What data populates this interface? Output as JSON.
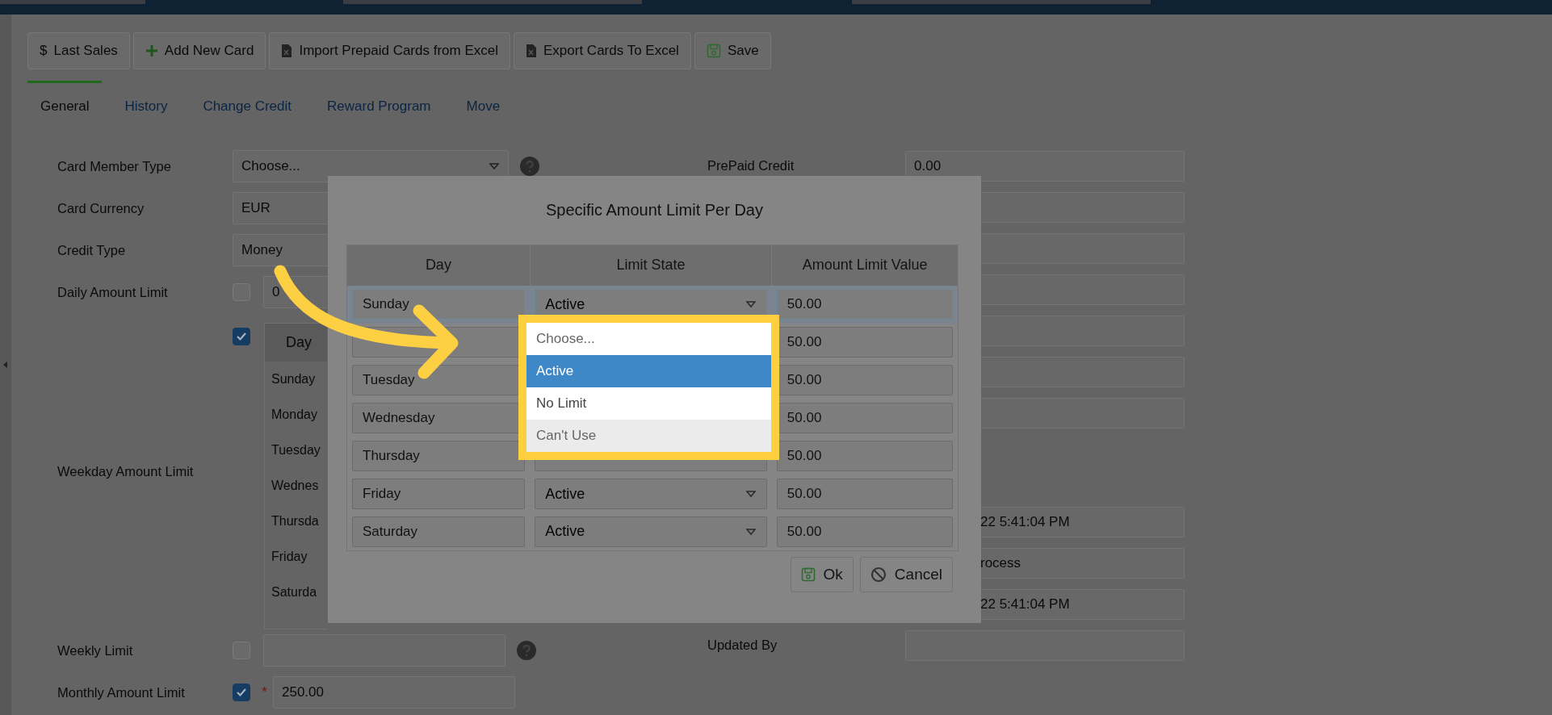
{
  "toolbar": [
    {
      "label": "Last Sales",
      "symbol": "$"
    },
    {
      "label": "Add New Card",
      "kind": "plus"
    },
    {
      "label": "Import Prepaid Cards from Excel",
      "kind": "excel"
    },
    {
      "label": "Export Cards To Excel",
      "kind": "excel"
    },
    {
      "label": "Save",
      "kind": "save"
    }
  ],
  "tabs": [
    {
      "label": "General",
      "selected": true
    },
    {
      "label": "History",
      "selected": false
    },
    {
      "label": "Change Credit",
      "selected": false
    },
    {
      "label": "Reward Program",
      "selected": false
    },
    {
      "label": "Move",
      "selected": false
    }
  ],
  "left_form": {
    "rows": [
      {
        "label": "Card Member Type",
        "kind": "select",
        "value": "Choose...",
        "help": true
      },
      {
        "label": "Card Currency",
        "kind": "text",
        "value": "EUR"
      },
      {
        "label": "Credit Type",
        "kind": "text",
        "value": "Money"
      },
      {
        "label": "Daily Amount Limit",
        "kind": "check_text",
        "checked": false,
        "value": "0"
      },
      {
        "label": "Weekday Amount Limit",
        "kind": "weekday_table",
        "checked": true,
        "header": "Day",
        "days": [
          "Sunday",
          "Monday",
          "Tuesday",
          "Wednes",
          "Thursda",
          "Friday",
          "Saturda"
        ]
      },
      {
        "label": "Weekly Limit",
        "kind": "check_text",
        "checked": false,
        "help": true
      },
      {
        "label": "Monthly Amount Limit",
        "kind": "check_text",
        "checked": true,
        "required": true,
        "required_mark": "*",
        "value": "250.00"
      }
    ]
  },
  "right_form": {
    "upper_rows": [
      {
        "label": "PrePaid Credit",
        "value": "0.00"
      },
      {},
      {},
      {},
      {},
      {},
      {}
    ],
    "lower_rows": [
      {
        "value": "22 5:41:04 PM"
      },
      {
        "value": "rocess"
      },
      {
        "value": "22 5:41:04 PM"
      },
      {
        "label": "Updated By"
      }
    ]
  },
  "modal": {
    "title": "Specific Amount Limit Per Day",
    "columns": [
      "Day",
      "Limit State",
      "Amount Limit Value"
    ],
    "rows": [
      {
        "day": "Sunday",
        "state": "Active",
        "amount": "50.00",
        "selected": true
      },
      {
        "amount": "50.00",
        "selected": false
      },
      {
        "day": "Tuesday",
        "amount": "50.00",
        "selected": false
      },
      {
        "day": "Wednesday",
        "amount": "50.00",
        "selected": false
      },
      {
        "day": "Thursday",
        "amount": "50.00",
        "selected": false
      },
      {
        "day": "Friday",
        "state": "Active",
        "amount": "50.00",
        "selected": false
      },
      {
        "day": "Saturday",
        "state": "Active",
        "amount": "50.00",
        "selected": false
      }
    ],
    "buttons": [
      {
        "label": "Ok",
        "kind": "save"
      },
      {
        "label": "Cancel",
        "kind": "ban"
      }
    ],
    "dropdown": {
      "options": [
        {
          "label": "Choose...",
          "selected": false,
          "hovered": false
        },
        {
          "label": "Active",
          "selected": true,
          "hovered": false
        },
        {
          "label": "No Limit",
          "selected": false,
          "hovered": false
        },
        {
          "label": "Can't Use",
          "selected": false,
          "hovered": true
        }
      ]
    }
  }
}
